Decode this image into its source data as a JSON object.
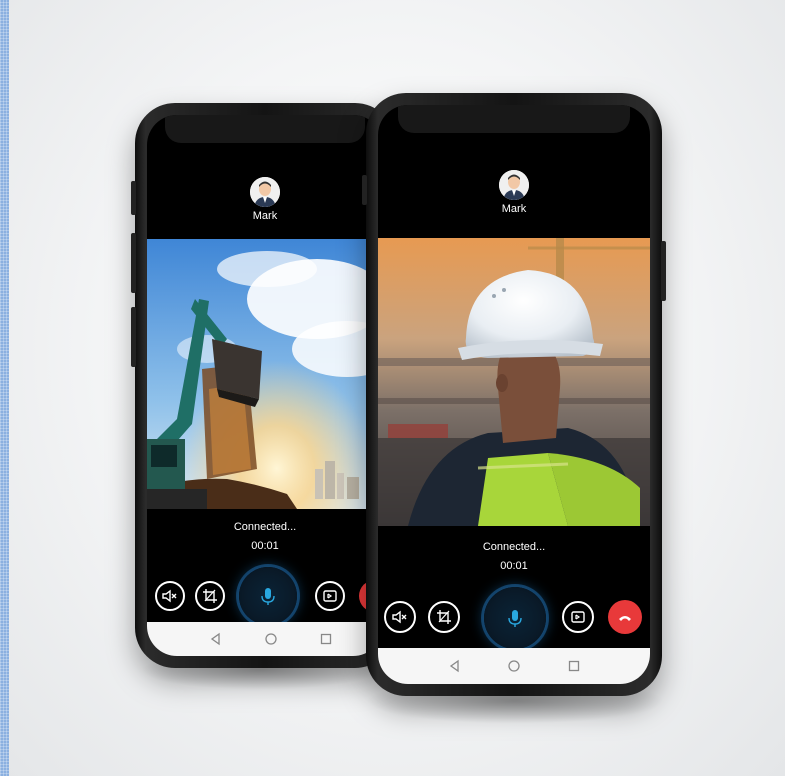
{
  "call": {
    "caller_name": "Mark",
    "status": "Connected...",
    "timer": "00:01"
  },
  "controls": {
    "mute_icon": "speaker-mute-icon",
    "crop_icon": "crop-icon",
    "mic_icon": "microphone-icon",
    "video_icon": "video-camera-icon",
    "end_icon": "phone-hangup-icon"
  },
  "navbar": {
    "back_icon": "triangle-back-icon",
    "home_icon": "circle-home-icon",
    "recents_icon": "square-recents-icon"
  },
  "colors": {
    "end_call": "#e8393a",
    "mic_accent": "#29a8e0",
    "screen_bg": "#000000",
    "navbar_bg": "#f6f6f6"
  }
}
